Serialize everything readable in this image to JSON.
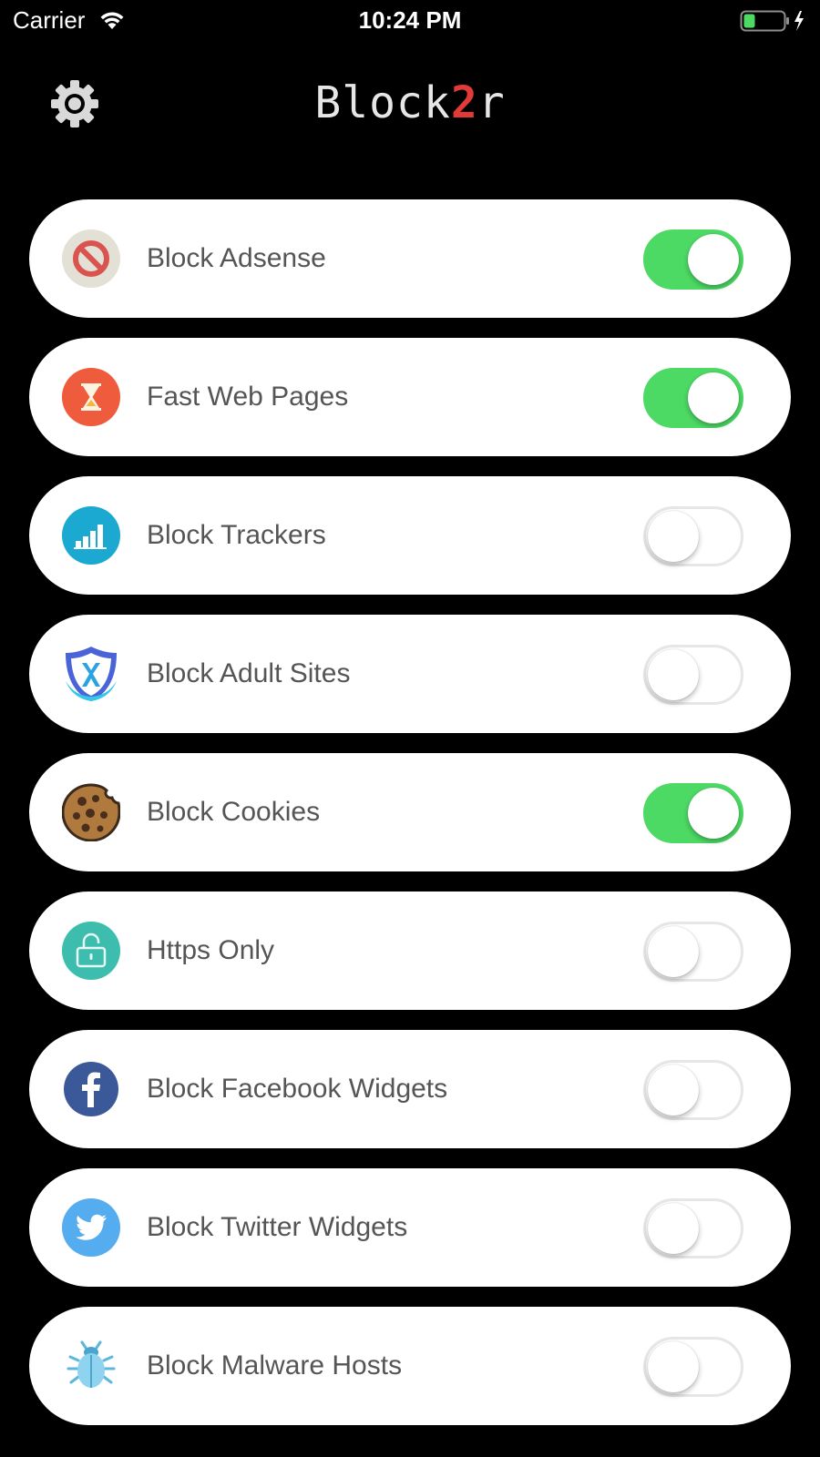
{
  "status_bar": {
    "carrier": "Carrier",
    "time": "10:24 PM"
  },
  "header": {
    "title_prefix": "Block",
    "title_accent": "2",
    "title_suffix": "r"
  },
  "colors": {
    "background": "#000000",
    "accent": "#e23a36",
    "toggle_on": "#4cd964",
    "row_label": "#555555"
  },
  "options": [
    {
      "label": "Block Adsense",
      "icon": "no-ads-icon",
      "enabled": true
    },
    {
      "label": "Fast Web Pages",
      "icon": "hourglass-icon",
      "enabled": true
    },
    {
      "label": "Block Trackers",
      "icon": "bar-chart-icon",
      "enabled": false
    },
    {
      "label": "Block Adult Sites",
      "icon": "shield-x-icon",
      "enabled": false
    },
    {
      "label": "Block Cookies",
      "icon": "cookie-icon",
      "enabled": true
    },
    {
      "label": "Https Only",
      "icon": "unlock-icon",
      "enabled": false
    },
    {
      "label": "Block Facebook Widgets",
      "icon": "facebook-icon",
      "enabled": false
    },
    {
      "label": "Block Twitter Widgets",
      "icon": "twitter-icon",
      "enabled": false
    },
    {
      "label": "Block Malware Hosts",
      "icon": "bug-icon",
      "enabled": false
    }
  ]
}
